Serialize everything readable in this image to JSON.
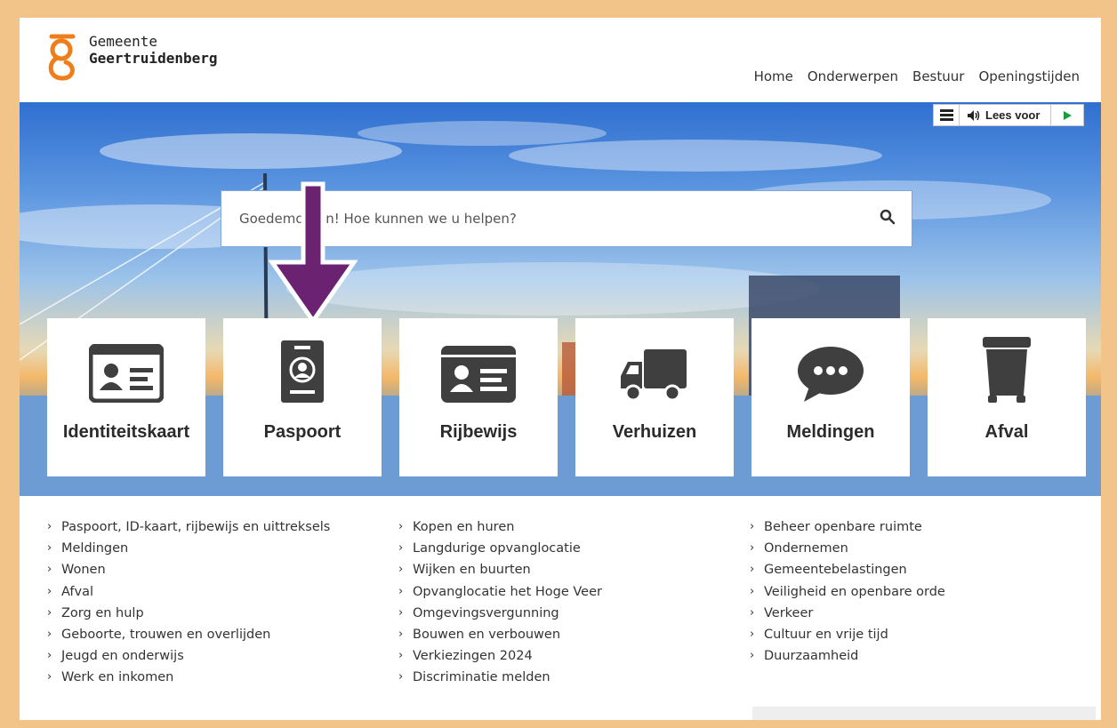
{
  "header": {
    "logo_line1": "Gemeente",
    "logo_line2": "Geertruidenberg",
    "nav": [
      "Home",
      "Onderwerpen",
      "Bestuur",
      "Openingstijden"
    ]
  },
  "readspeaker": {
    "menu_icon": "hamburger-icon",
    "listen_label": "Lees voor",
    "play_icon": "play-icon"
  },
  "search": {
    "placeholder": "Goedemorgen! Hoe kunnen we u helpen?",
    "icon": "search-icon"
  },
  "tiles": [
    {
      "label": "Identiteitskaart",
      "icon": "id-card-icon"
    },
    {
      "label": "Paspoort",
      "icon": "passport-icon"
    },
    {
      "label": "Rijbewijs",
      "icon": "drivers-license-icon"
    },
    {
      "label": "Verhuizen",
      "icon": "truck-icon"
    },
    {
      "label": "Meldingen",
      "icon": "chat-bubble-icon"
    },
    {
      "label": "Afval",
      "icon": "trash-bin-icon"
    }
  ],
  "links": {
    "col1": [
      "Paspoort, ID-kaart, rijbewijs en uittreksels",
      "Meldingen",
      "Wonen",
      "Afval",
      "Zorg en hulp",
      "Geboorte, trouwen en overlijden",
      "Jeugd en onderwijs",
      "Werk en inkomen"
    ],
    "col2": [
      "Kopen en huren",
      "Langdurige opvanglocatie",
      "Wijken en buurten",
      "Opvanglocatie het Hoge Veer",
      "Omgevingsvergunning",
      "Bouwen en verbouwen",
      "Verkiezingen 2024",
      "Discriminatie melden"
    ],
    "col3": [
      "Beheer openbare ruimte",
      "Ondernemen",
      "Gemeentebelastingen",
      "Veiligheid en openbare orde",
      "Verkeer",
      "Cultuur en vrije tijd",
      "Duurzaamheid"
    ]
  },
  "colors": {
    "frame": "#f3c48a",
    "logo_orange": "#ef7d1a",
    "arrow_purple": "#6b2270",
    "icon_dark": "#3f3f3f",
    "play_green": "#1e9b3a"
  }
}
